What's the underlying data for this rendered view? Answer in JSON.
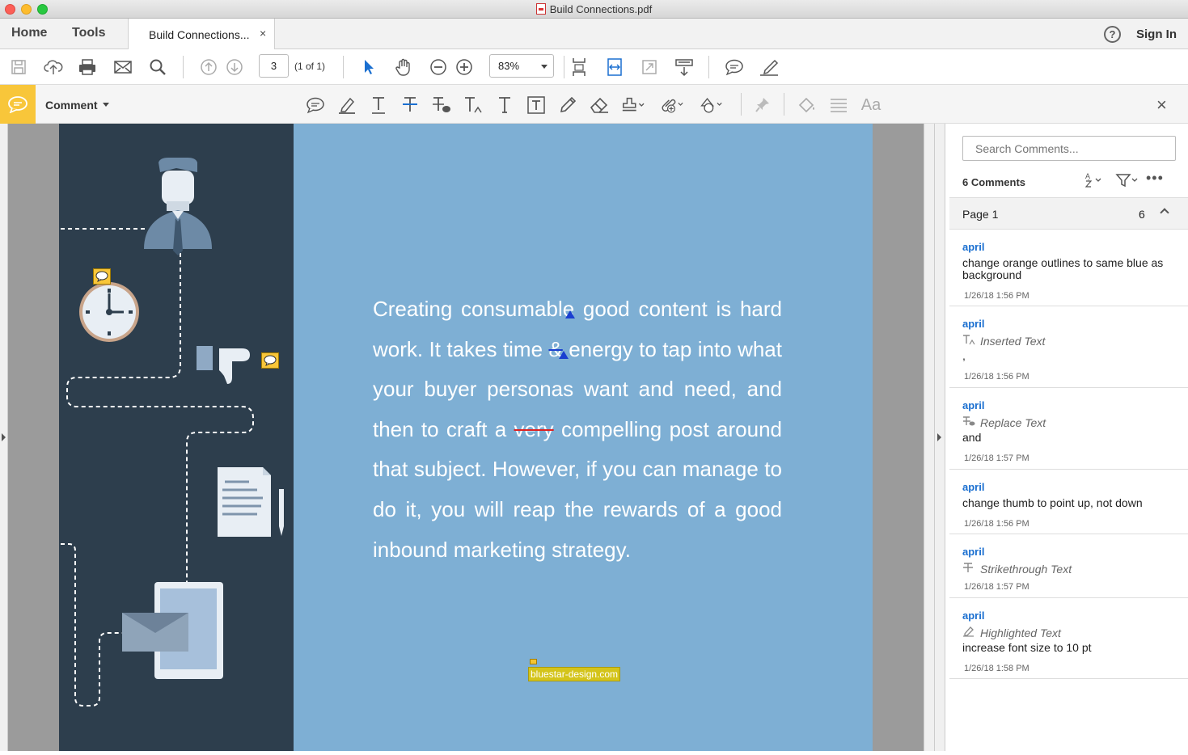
{
  "window": {
    "title": "Build Connections.pdf",
    "traffic_lights": {
      "close": "#fc5f57",
      "minimize": "#fdbc2e",
      "zoom": "#28c840"
    }
  },
  "tabs": {
    "home": "Home",
    "tools": "Tools",
    "document": "Build Connections...",
    "close": "×",
    "help": "?",
    "sign_in": "Sign In"
  },
  "toolbar": {
    "page_number": "3",
    "page_of": "(1 of 1)",
    "zoom": "83%",
    "icons": [
      "save-icon",
      "cloud-upload-icon",
      "print-icon",
      "email-icon",
      "search-icon",
      "page-up-icon",
      "page-down-icon",
      "select-arrow-icon",
      "hand-icon",
      "zoom-out-icon",
      "zoom-in-icon",
      "fit-page-icon",
      "fit-width-icon",
      "full-screen-icon",
      "scroll-mode-icon",
      "comment-bubble-icon",
      "sign-icon"
    ]
  },
  "comment_bar": {
    "label": "Comment",
    "close": "×",
    "accent": "#f8c63a",
    "tools": [
      "sticky-note-icon",
      "highlight-icon",
      "underline-text-icon",
      "strikethrough-icon",
      "replace-text-icon",
      "insert-text-icon",
      "add-text-icon",
      "text-box-icon",
      "pencil-icon",
      "eraser-icon",
      "stamp-icon",
      "attach-file-icon",
      "shapes-icon",
      "pin-icon",
      "fill-color-icon",
      "line-style-icon",
      "font-size-icon"
    ]
  },
  "document": {
    "colors": {
      "page_bg": "#7eafd4",
      "left_panel": "#2d3e4d"
    },
    "body_parts": {
      "p1": "Creating consumable good content is hard work. It takes time ",
      "p2": "&",
      "p3": " energy to tap into what your buyer personas want and need, and then to craft a ",
      "p4": "very",
      "p5": " compelling post around that subject. However, if you can manage to do it, you will reap the rewards of a good inbound marketing strategy."
    },
    "footer_link": "bluestar-design.com"
  },
  "comments_panel": {
    "search_placeholder": "Search Comments...",
    "count_label": "6 Comments",
    "page_label": "Page 1",
    "page_count": "6",
    "items": [
      {
        "author": "april",
        "type": "",
        "text": "change orange outlines to same blue as background",
        "date": "1/26/18  1:56 PM"
      },
      {
        "author": "april",
        "type": "Inserted Text",
        "text": ",",
        "date": "1/26/18  1:56 PM"
      },
      {
        "author": "april",
        "type": "Replace Text",
        "text": "and",
        "date": "1/26/18  1:57 PM"
      },
      {
        "author": "april",
        "type": "",
        "text": "change thumb to point up, not down",
        "date": "1/26/18  1:56 PM"
      },
      {
        "author": "april",
        "type": "Strikethrough Text",
        "text": "",
        "date": "1/26/18  1:57 PM"
      },
      {
        "author": "april",
        "type": "Highlighted Text",
        "text": "increase font size to 10 pt",
        "date": "1/26/18  1:58 PM"
      }
    ]
  }
}
